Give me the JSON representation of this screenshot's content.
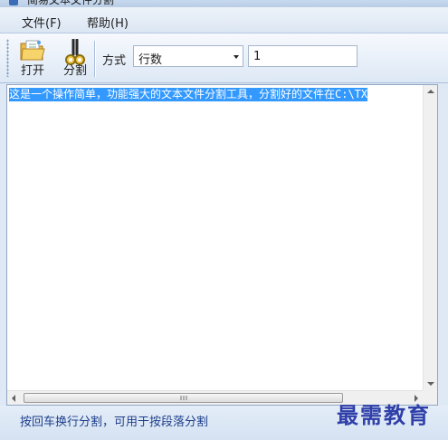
{
  "window": {
    "title": "简易文本文件分割"
  },
  "menu": {
    "items": [
      "文件(F)",
      "帮助(H)"
    ]
  },
  "toolbar": {
    "open_label": "打开",
    "split_label": "分割",
    "mode_label": "方式",
    "mode_value": "行数",
    "count_value": "1"
  },
  "editor": {
    "content": "这是一个操作简单，功能强大的文本文件分割工具，分割好的文件在C:\\TX"
  },
  "scrollbar": {
    "grip": "Ⅲ"
  },
  "status": {
    "text": "按回车换行分割，可用于按段落分割"
  },
  "watermark": {
    "text": "最需教育"
  }
}
